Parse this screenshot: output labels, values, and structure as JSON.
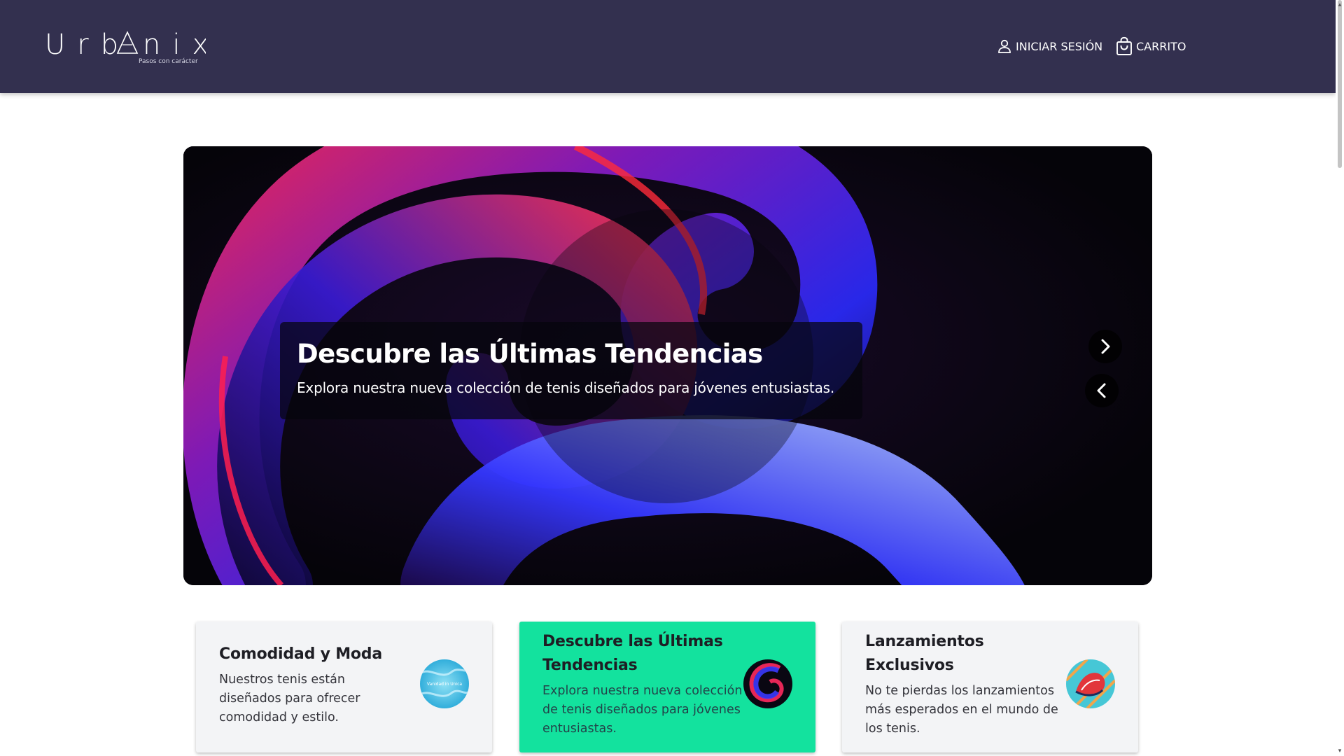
{
  "brand": {
    "logo_text": "Urbanix",
    "tagline": "Pasos con carácter"
  },
  "nav": {
    "login_label": "INICIAR SESIÓN",
    "login_icon": "user-icon",
    "cart_label": "CARRITO",
    "cart_icon": "shopping-bag-icon"
  },
  "hero": {
    "title": "Descubre las Últimas Tendencias",
    "subtitle": "Explora nuestra nueva colección de tenis diseñados para jóvenes entusiastas.",
    "next_icon": "chevron-right-icon",
    "prev_icon": "chevron-left-icon"
  },
  "cards": [
    {
      "title": "Comodidad y Moda",
      "text": "Nuestros tenis están diseñados para ofrecer comodidad y estilo.",
      "image_text": "Vanidad in Unica",
      "background": "#f3f4f6"
    },
    {
      "title": "Descubre las Últimas Tendencias",
      "text": "Explora nuestra nueva colección de tenis diseñados para jóvenes entusiastas.",
      "background": "#13e29e"
    },
    {
      "title": "Lanzamientos Exclusivos",
      "text": "No te pierdas los lanzamientos más esperados en el mundo de los tenis.",
      "background": "#f3f4f6"
    }
  ],
  "colors": {
    "header": "#33304f",
    "accent": "#13e29e",
    "card": "#f3f4f6"
  }
}
